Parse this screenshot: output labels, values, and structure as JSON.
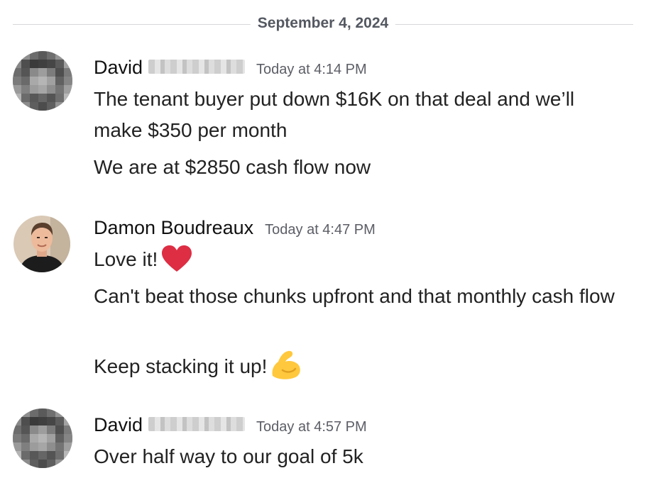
{
  "date_divider": "September 4, 2024",
  "messages": [
    {
      "author": "David",
      "author_surname_redacted": true,
      "timestamp": "Today at 4:14 PM",
      "lines": [
        "The tenant buyer put down $16K on that deal and we’ll make $350 per month",
        "We are at $2850 cash flow now"
      ]
    },
    {
      "author": "Damon Boudreaux",
      "timestamp": "Today at 4:47 PM",
      "lines": [
        "Love it!",
        "Can't beat those chunks upfront and that monthly cash flow",
        "Keep stacking it up!"
      ],
      "emojis": [
        "red-heart",
        "flexed-biceps"
      ]
    },
    {
      "author": "David",
      "author_surname_redacted": true,
      "timestamp": "Today at 4:57 PM",
      "lines": [
        "Over half way to our goal of 5k"
      ]
    }
  ],
  "colors": {
    "divider_line": "#d8d8da",
    "divider_text": "#545861",
    "timestamp": "#5c5e66",
    "heart": "#dd2e44",
    "biceps": "#ffc83d"
  }
}
